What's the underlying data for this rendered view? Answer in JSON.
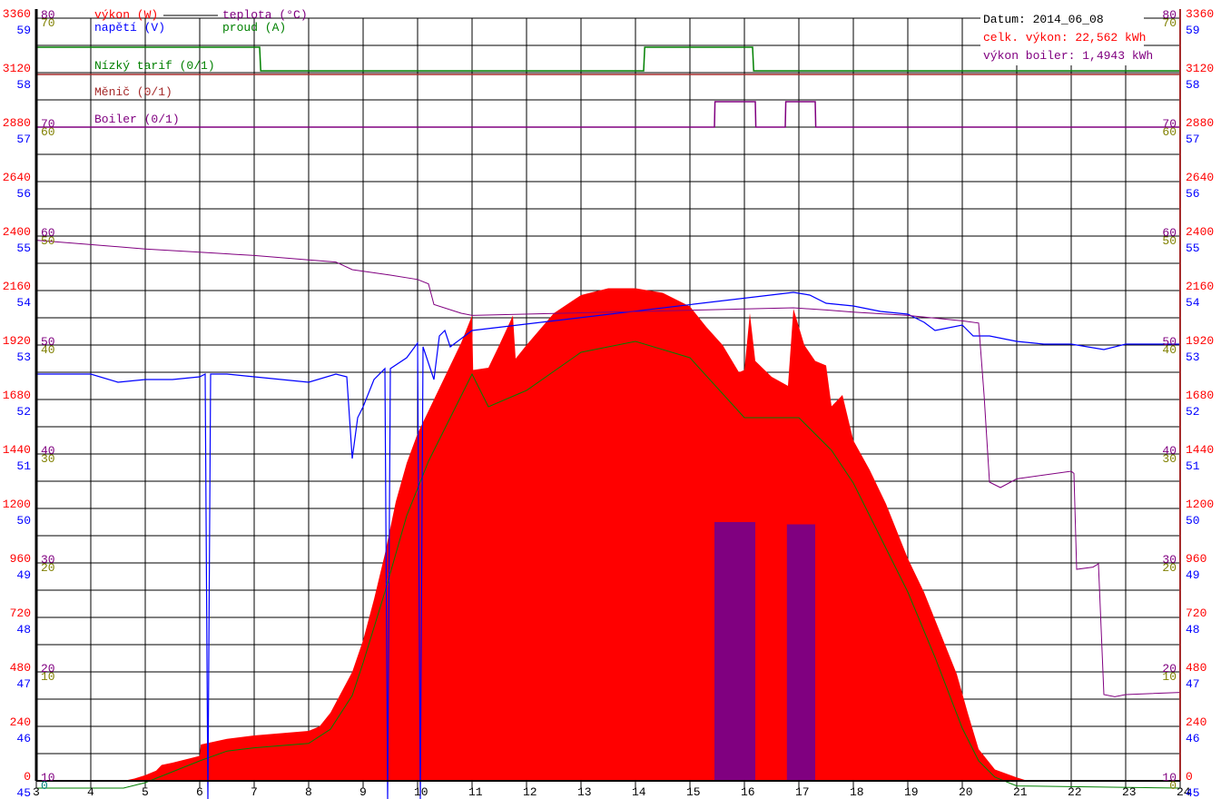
{
  "chart_data": {
    "type": "line",
    "title": "",
    "info": {
      "date": "Datum: 2014_06_08",
      "total_power": "celk. výkon: 22,562 kWh",
      "boiler_power": "výkon boiler: 1,4943 kWh"
    },
    "legend": {
      "power": "výkon (W)",
      "voltage": "napětí (V)",
      "temperature": "teplota (°C)",
      "current": "proud (A)",
      "low_tariff": "Nízký tarif (0/1)",
      "inverter": "Měnič (0/1)",
      "boiler": "Boiler (0/1)"
    },
    "colors": {
      "power": "#ff0000",
      "voltage": "#0000ff",
      "temperature": "#800080",
      "current": "#008000",
      "low_tariff": "#008000",
      "inverter": "#a52a2a",
      "boiler": "#800080",
      "boiler_fill": "#800080",
      "grid": "#000000",
      "current_label": "#808000"
    },
    "x_axis": {
      "range": [
        3,
        24
      ],
      "ticks": [
        3,
        4,
        5,
        6,
        7,
        8,
        9,
        10,
        11,
        12,
        13,
        14,
        15,
        16,
        17,
        18,
        19,
        20,
        21,
        22,
        23,
        24
      ]
    },
    "power_axis": {
      "range": [
        0,
        3360
      ],
      "ticks": [
        0,
        240,
        480,
        720,
        960,
        1200,
        1440,
        1680,
        1920,
        2160,
        2400,
        2640,
        2880,
        3120,
        3360
      ]
    },
    "voltage_axis": {
      "range": [
        45,
        59
      ],
      "ticks": [
        45,
        46,
        47,
        48,
        49,
        50,
        51,
        52,
        53,
        54,
        55,
        56,
        57,
        58,
        59
      ]
    },
    "temperature_axis": {
      "ticks": [
        10,
        20,
        30,
        40,
        50,
        60,
        70,
        80
      ]
    },
    "current_axis": {
      "ticks": [
        0,
        10,
        20,
        30,
        40,
        50,
        60,
        70
      ]
    },
    "series": [
      {
        "name": "power_W",
        "x": [
          3,
          4.6,
          4.8,
          5,
          5.2,
          5.3,
          5.5,
          6,
          6.02,
          6.5,
          7,
          7.5,
          8,
          8.2,
          8.4,
          8.6,
          8.8,
          9,
          9.2,
          9.4,
          9.6,
          9.8,
          10,
          10.3,
          10.5,
          10.8,
          11,
          11.02,
          11.3,
          11.5,
          11.75,
          11.8,
          12,
          12.5,
          13,
          13.5,
          14,
          14.5,
          15,
          15.3,
          15.6,
          15.9,
          16,
          16.1,
          16.2,
          16.5,
          16.8,
          16.9,
          17.1,
          17.3,
          17.5,
          17.6,
          17.8,
          18,
          18.3,
          18.6,
          19,
          19.3,
          19.6,
          19.9,
          20.1,
          20.3,
          20.6,
          21,
          21.2,
          24
        ],
        "values": [
          0,
          0,
          10,
          25,
          45,
          70,
          80,
          110,
          160,
          185,
          200,
          210,
          220,
          240,
          300,
          390,
          480,
          620,
          800,
          1000,
          1230,
          1400,
          1530,
          1680,
          1780,
          1930,
          2050,
          1810,
          1820,
          1920,
          2050,
          1860,
          1920,
          2060,
          2140,
          2170,
          2170,
          2150,
          2090,
          2000,
          1920,
          1800,
          1810,
          2060,
          1850,
          1780,
          1740,
          2080,
          1920,
          1850,
          1830,
          1650,
          1700,
          1500,
          1370,
          1220,
          980,
          830,
          650,
          470,
          300,
          140,
          50,
          15,
          0,
          0
        ]
      },
      {
        "name": "current_A",
        "x": [
          3,
          4.6,
          5,
          5.5,
          6,
          6.5,
          7,
          8,
          8.4,
          8.8,
          9,
          9.4,
          9.8,
          10.2,
          10.6,
          11,
          11.3,
          12,
          13,
          14,
          15,
          16,
          17,
          17.6,
          18,
          18.5,
          19,
          19.5,
          20,
          20.3,
          20.6,
          21,
          24
        ],
        "values": [
          0,
          0,
          0.5,
          1.5,
          2.5,
          3.4,
          3.7,
          4.1,
          5.4,
          8.5,
          11.5,
          18,
          25,
          30,
          34,
          38,
          35,
          36.5,
          40,
          41,
          39.5,
          34,
          34,
          31,
          28,
          23,
          18,
          12,
          5.5,
          2.5,
          1,
          0.2,
          0
        ]
      },
      {
        "name": "voltage_V",
        "x": [
          3,
          4,
          4.5,
          5,
          5.5,
          6,
          6.1,
          6.15,
          6.2,
          6.5,
          7,
          7.5,
          8,
          8.5,
          8.7,
          8.8,
          8.9,
          9,
          9.2,
          9.4,
          9.45,
          9.5,
          9.8,
          10,
          10.05,
          10.1,
          10.3,
          10.4,
          10.5,
          10.6,
          11,
          16.9,
          17.2,
          17.5,
          18,
          18.5,
          19,
          19.3,
          19.5,
          20,
          20.2,
          20.5,
          21,
          21.5,
          22,
          22.3,
          22.6,
          23,
          23.5,
          24
        ],
        "values": [
          52.6,
          52.6,
          52.45,
          52.5,
          52.5,
          52.55,
          52.6,
          44.8,
          52.6,
          52.6,
          52.55,
          52.5,
          52.45,
          52.6,
          52.55,
          51.05,
          51.8,
          52.0,
          52.5,
          52.7,
          44.8,
          52.7,
          52.9,
          53.17,
          44.8,
          53.1,
          52.5,
          53.3,
          53.4,
          53.1,
          53.4,
          54.1,
          54.05,
          53.9,
          53.85,
          53.75,
          53.7,
          53.55,
          53.4,
          53.5,
          53.3,
          53.3,
          53.2,
          53.15,
          53.15,
          53.1,
          53.05,
          53.15,
          53.15,
          53.15
        ]
      },
      {
        "name": "temperature_C",
        "x": [
          3,
          4,
          5,
          6,
          7,
          8,
          8.5,
          8.8,
          9.5,
          10,
          10.2,
          10.3,
          10.8,
          11,
          16.9,
          17.5,
          18,
          19,
          20,
          20.3,
          20.4,
          20.5,
          20.7,
          21,
          22,
          22.05,
          22.1,
          22.4,
          22.5,
          22.6,
          22.8,
          23,
          24
        ],
        "values": [
          59.2,
          58.8,
          58.4,
          58.1,
          57.8,
          57.4,
          57.2,
          56.5,
          56.0,
          55.6,
          55.2,
          53.3,
          52.5,
          52.3,
          53.0,
          52.8,
          52.6,
          52.3,
          51.8,
          51.6,
          45,
          37,
          36.5,
          37.3,
          38,
          37.8,
          29.0,
          29.2,
          29.5,
          17.5,
          17.3,
          17.5,
          17.7
        ]
      },
      {
        "name": "low_tariff",
        "x": [
          3,
          7.1,
          7.12,
          14.15,
          14.17,
          16.15,
          16.17,
          24
        ],
        "values": [
          1,
          1,
          0,
          0,
          1,
          1,
          0,
          0
        ]
      },
      {
        "name": "inverter",
        "x": [
          3,
          24
        ],
        "values": [
          0,
          0
        ]
      },
      {
        "name": "boiler",
        "x": [
          3,
          15.45,
          15.46,
          16.2,
          16.21,
          16.75,
          16.76,
          17.3,
          17.31,
          24
        ],
        "values": [
          0,
          0,
          1,
          1,
          0,
          0,
          1,
          1,
          0,
          0
        ]
      },
      {
        "name": "boiler_power_W",
        "blocks": [
          {
            "from": 15.45,
            "to": 16.2,
            "value": 1140
          },
          {
            "from": 16.78,
            "to": 17.3,
            "value": 1130
          }
        ]
      }
    ]
  }
}
